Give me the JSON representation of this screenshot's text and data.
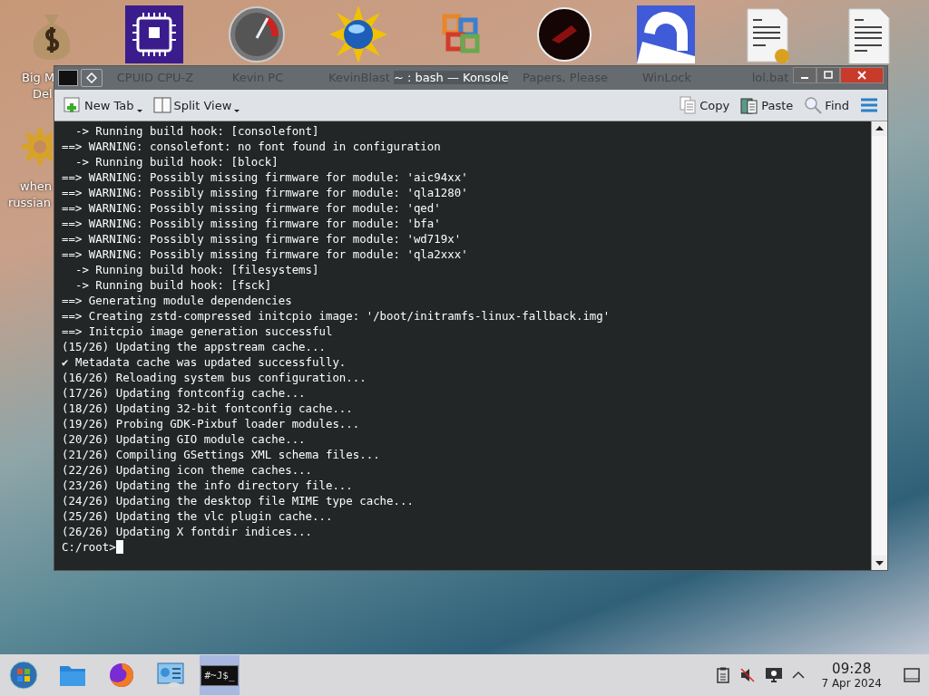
{
  "desktop_icons": [
    {
      "kind": "money-bag",
      "label": "Big M",
      "label_2": "Del"
    },
    {
      "kind": "chip",
      "label": "CPUID CPU-Z"
    },
    {
      "kind": "gauge",
      "label": "Kevin PC"
    },
    {
      "kind": "globe",
      "label": "KevinBlast"
    },
    {
      "kind": "office"
    },
    {
      "kind": "dark-disc",
      "label": "Papers, Please"
    },
    {
      "kind": "lock",
      "label": "WinLock"
    },
    {
      "kind": "script",
      "label": "lol.bat"
    },
    {
      "kind": "document"
    }
  ],
  "side_icon": {
    "kind": "gear",
    "label": "when",
    "label_2": "russian"
  },
  "window": {
    "title": "~ : bash — Konsole",
    "toolbar": {
      "left": [
        {
          "kind": "new-tab",
          "label": "New Tab",
          "dropdown": true
        },
        {
          "kind": "split",
          "label": "Split View",
          "dropdown": true
        }
      ],
      "right": [
        {
          "kind": "copy",
          "label": "Copy"
        },
        {
          "kind": "paste",
          "label": "Paste"
        },
        {
          "kind": "find",
          "label": "Find"
        }
      ]
    },
    "terminal": {
      "lines": [
        "  -> Running build hook: [consolefont]",
        "==> WARNING: consolefont: no font found in configuration",
        "  -> Running build hook: [block]",
        "==> WARNING: Possibly missing firmware for module: 'aic94xx'",
        "==> WARNING: Possibly missing firmware for module: 'qla1280'",
        "==> WARNING: Possibly missing firmware for module: 'qed'",
        "==> WARNING: Possibly missing firmware for module: 'bfa'",
        "==> WARNING: Possibly missing firmware for module: 'wd719x'",
        "==> WARNING: Possibly missing firmware for module: 'qla2xxx'",
        "  -> Running build hook: [filesystems]",
        "  -> Running build hook: [fsck]",
        "==> Generating module dependencies",
        "==> Creating zstd-compressed initcpio image: '/boot/initramfs-linux-fallback.img'",
        "==> Initcpio image generation successful",
        "(15/26) Updating the appstream cache...",
        "✔ Metadata cache was updated successfully.",
        "(16/26) Reloading system bus configuration...",
        "(17/26) Updating fontconfig cache...",
        "(18/26) Updating 32-bit fontconfig cache...",
        "(19/26) Probing GDK-Pixbuf loader modules...",
        "(20/26) Updating GIO module cache...",
        "(21/26) Compiling GSettings XML schema files...",
        "(22/26) Updating icon theme caches...",
        "(23/26) Updating the info directory file...",
        "(24/26) Updating the desktop file MIME type cache...",
        "(25/26) Updating the vlc plugin cache...",
        "(26/26) Updating X fontdir indices..."
      ],
      "prompt": "C:/root>"
    }
  },
  "taskbar": {
    "items": [
      {
        "kind": "start",
        "selected": false
      },
      {
        "kind": "files",
        "selected": false
      },
      {
        "kind": "browser",
        "selected": false
      },
      {
        "kind": "settings",
        "selected": false
      },
      {
        "kind": "terminal",
        "label": "#~J$_",
        "selected": true
      }
    ],
    "tray": [
      {
        "kind": "clipboard"
      },
      {
        "kind": "muted"
      },
      {
        "kind": "display"
      },
      {
        "kind": "chevron"
      }
    ],
    "time": "09:28",
    "date": "7 Apr 2024"
  }
}
